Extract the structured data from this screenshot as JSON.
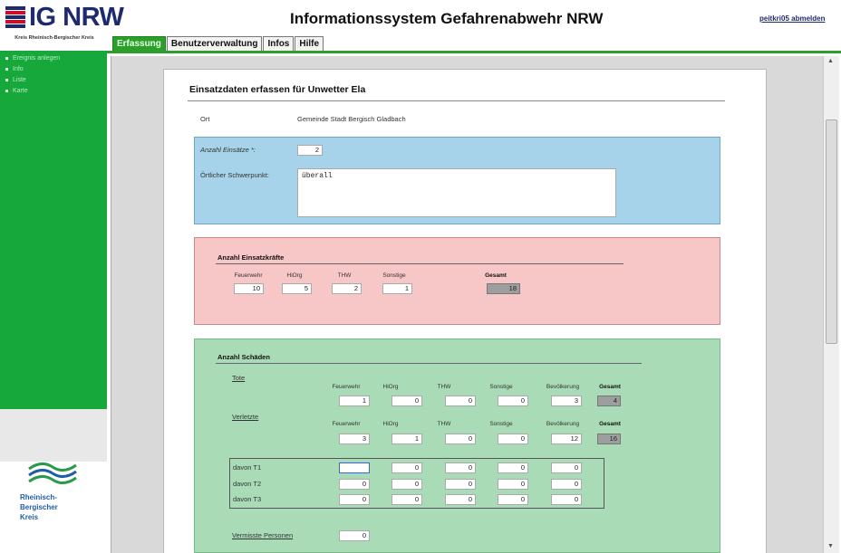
{
  "header": {
    "logo_text": "IG NRW",
    "app_title": "Informationssystem Gefahrenabwehr NRW",
    "logout_link": "peitkri05 abmelden",
    "kreis_label": "Kreis Rheinisch-Bergischer Kreis"
  },
  "tabs": [
    {
      "label": "Erfassung",
      "active": true
    },
    {
      "label": "Benutzerverwaltung",
      "active": false
    },
    {
      "label": "Infos",
      "active": false
    },
    {
      "label": "Hilfe",
      "active": false
    }
  ],
  "sidebar": {
    "items": [
      {
        "label": "Ereignis anlegen"
      },
      {
        "label": "Info"
      },
      {
        "label": "Liste"
      },
      {
        "label": "Karte"
      }
    ],
    "footer_logo": [
      "Rheinisch-",
      "Bergischer",
      "Kreis"
    ]
  },
  "form": {
    "title": "Einsatzdaten erfassen für Unwetter Ela",
    "ort_label": "Ort",
    "ort_value": "Gemeinde Stadt Bergisch Gladbach",
    "anzahl_einsaetze_label": "Anzahl Einsätze *:",
    "anzahl_einsaetze_value": "2",
    "schwerpunkt_label": "Örtlicher Schwerpunkt:",
    "schwerpunkt_value": "überall",
    "einsatzkraefte": {
      "heading": "Anzahl Einsatzkräfte",
      "columns": [
        "Feuerwehr",
        "HiOrg",
        "THW",
        "Sonstige"
      ],
      "values": [
        "10",
        "5",
        "2",
        "1"
      ],
      "total_label": "Gesamt",
      "total_value": "18"
    },
    "schaeden": {
      "heading": "Anzahl Schäden",
      "tote_label": "Tote",
      "verletzte_label": "Verletzte",
      "columns": [
        "Feuerwehr",
        "HiOrg",
        "THW",
        "Sonstige",
        "Bevölkerung"
      ],
      "total_label": "Gesamt",
      "tote_values": [
        "1",
        "0",
        "0",
        "0",
        "3"
      ],
      "tote_total": "4",
      "verletzte_values": [
        "3",
        "1",
        "0",
        "0",
        "12"
      ],
      "verletzte_total": "16",
      "davon": [
        {
          "label": "davon T1",
          "values": [
            "",
            "0",
            "0",
            "0",
            "0"
          ]
        },
        {
          "label": "davon T2",
          "values": [
            "0",
            "0",
            "0",
            "0",
            "0"
          ]
        },
        {
          "label": "davon T3",
          "values": [
            "0",
            "0",
            "0",
            "0",
            "0"
          ]
        }
      ],
      "vermisste_label": "Vermisste Personen",
      "vermisste_value": "0"
    }
  },
  "colors": {
    "accent_green": "#2aa02a",
    "sidebar_green": "#16a83a",
    "panel_blue": "#a7d3ea",
    "panel_red": "#f7c6c6",
    "panel_green": "#a9dcb6",
    "logo_blue": "#1d2a6e"
  }
}
